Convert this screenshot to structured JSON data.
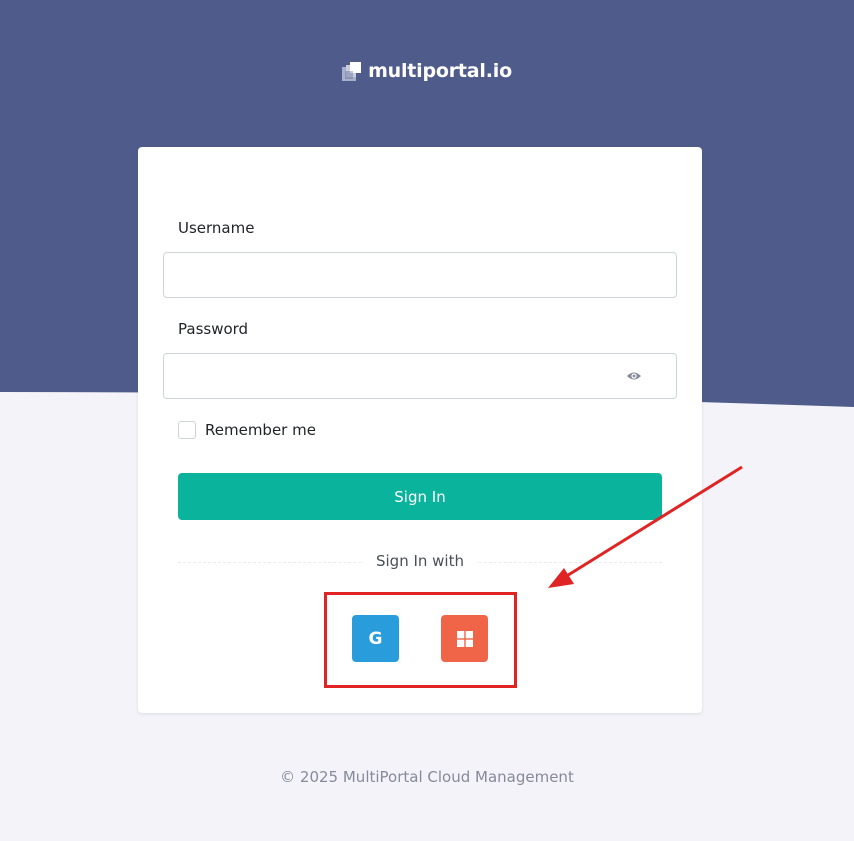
{
  "brand": {
    "name": "multiportal.io"
  },
  "login": {
    "username_label": "Username",
    "username_value": "",
    "password_label": "Password",
    "password_value": "",
    "remember_label": "Remember me",
    "signin_label": "Sign In",
    "signin_with_label": "Sign In with"
  },
  "social": {
    "google_glyph": "G",
    "google_icon": "google-icon",
    "microsoft_icon": "microsoft-icon"
  },
  "footer": {
    "text": "© 2025 MultiPortal Cloud Management"
  },
  "colors": {
    "hero": "#4f5b8a",
    "accent": "#0ab39c",
    "google": "#299cdb",
    "microsoft": "#f06548",
    "annotation": "#e02424"
  }
}
